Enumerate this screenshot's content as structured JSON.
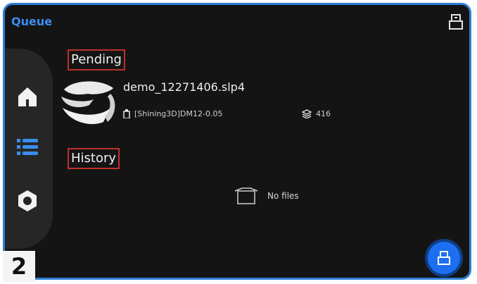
{
  "header": {
    "title": "Queue"
  },
  "sidebar": {
    "items": [
      "home-icon",
      "list-icon",
      "gear-icon"
    ],
    "active_index": 1,
    "active_color": "#3a8ef0"
  },
  "pending": {
    "label": "Pending",
    "file_name": "demo_12271406.slp4",
    "material": "[Shining3D]DM12-0.05",
    "layers": "416"
  },
  "history": {
    "label": "History",
    "empty_text": "No files"
  },
  "badge": {
    "text": "2"
  },
  "colors": {
    "accent": "#3a8ef0",
    "highlight_box": "#c0302c",
    "background": "#141414"
  }
}
